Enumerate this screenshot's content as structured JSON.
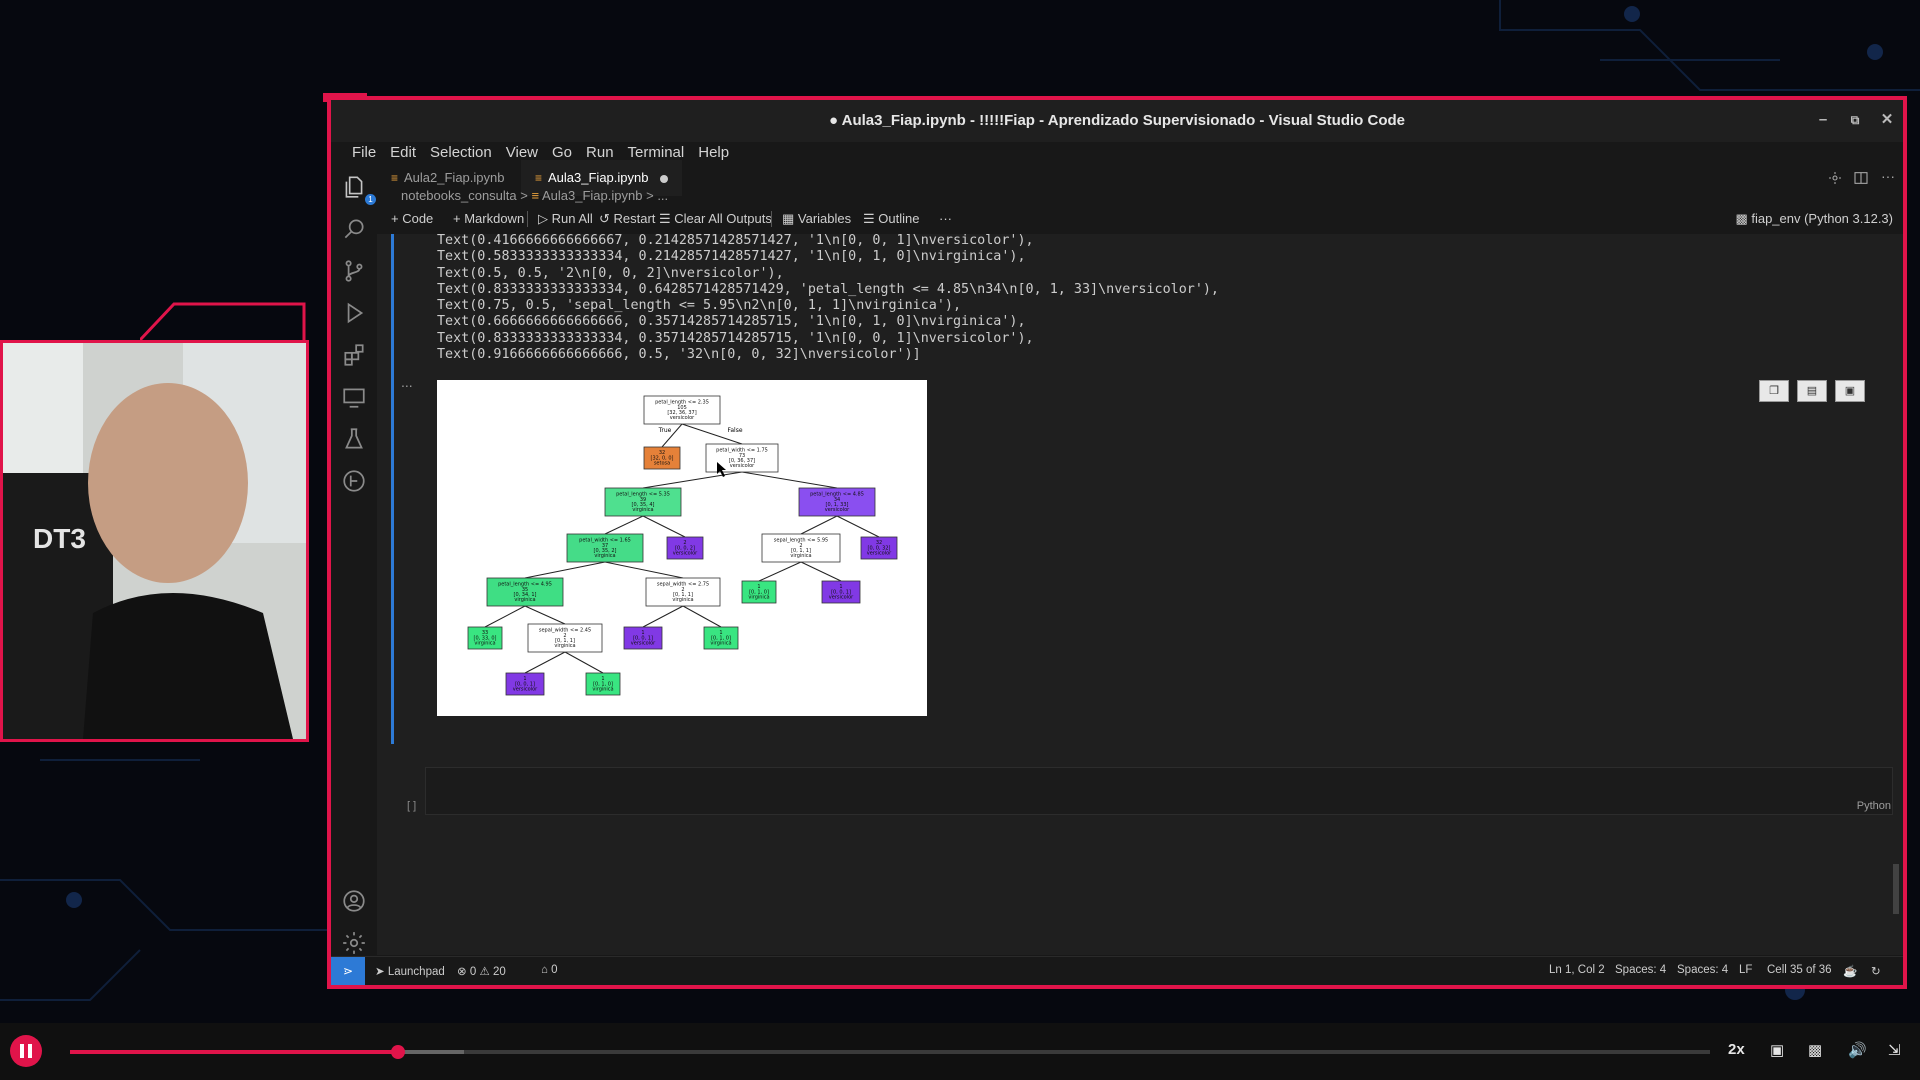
{
  "colors": {
    "accent": "#e0144a",
    "vscode_blue": "#2d7ad6",
    "notebook_icon": "#e8a03b"
  },
  "window": {
    "title": "● Aula3_Fiap.ipynb - !!!!!Fiap - Aprendizado Supervisionado - Visual Studio Code",
    "minimize_label": "–",
    "restore_label": "⧉",
    "close_label": "✕"
  },
  "menu": [
    "File",
    "Edit",
    "Selection",
    "View",
    "Go",
    "Run",
    "Terminal",
    "Help"
  ],
  "activity_bar": {
    "explorer_badge": "1"
  },
  "tabs": [
    {
      "label": "Aula2_Fiap.ipynb",
      "active": false
    },
    {
      "label": "Aula3_Fiap.ipynb",
      "active": true,
      "dirty": true
    }
  ],
  "breadcrumb": {
    "folder": "notebooks_consulta",
    "file": "Aula3_Fiap.ipynb",
    "more": "..."
  },
  "toolbar": {
    "code": "+ Code",
    "markdown": "+ Markdown",
    "run_all": "▷ Run All",
    "restart": "↺ Restart",
    "clear": "Clear All Outputs",
    "variables": "Variables",
    "outline": "Outline",
    "more": "···",
    "kernel": "fiap_env (Python 3.12.3)"
  },
  "output_lines": [
    "Text(0.4166666666666667, 0.21428571428571427, '1\\n[0, 0, 1]\\nversicolor'),",
    "Text(0.5833333333333334, 0.21428571428571427, '1\\n[0, 1, 0]\\nvirginica'),",
    "Text(0.5, 0.5, '2\\n[0, 0, 2]\\nversicolor'),",
    "Text(0.8333333333333334, 0.6428571428571429, 'petal_length <= 4.85\\n34\\n[0, 1, 33]\\nversicolor'),",
    "Text(0.75, 0.5, 'sepal_length <= 5.95\\n2\\n[0, 1, 1]\\nvirginica'),",
    "Text(0.6666666666666666, 0.35714285714285715, '1\\n[0, 1, 0]\\nvirginica'),",
    "Text(0.8333333333333334, 0.35714285714285715, '1\\n[0, 0, 1]\\nversicolor'),",
    "Text(0.9166666666666666, 0.5, '32\\n[0, 0, 32]\\nversicolor')]"
  ],
  "output_ellipsis": "...",
  "tree": {
    "true_label": "True",
    "false_label": "False",
    "nodes": [
      {
        "id": "n0",
        "lines": [
          "petal_length <= 2.35",
          "105",
          "[32, 36, 37]",
          "versicolor"
        ],
        "fill": "#ffffff"
      },
      {
        "id": "n1",
        "lines": [
          "32",
          "[32, 0, 0]",
          "setosa"
        ],
        "fill": "#e58139"
      },
      {
        "id": "n2",
        "lines": [
          "petal_width <= 1.75",
          "73",
          "[0, 36, 37]",
          "versicolor"
        ],
        "fill": "#ffffff"
      },
      {
        "id": "n3",
        "lines": [
          "petal_length <= 5.35",
          "39",
          "[0, 35, 4]",
          "virginica"
        ],
        "fill": "#4fe08f"
      },
      {
        "id": "n4",
        "lines": [
          "petal_length <= 4.85",
          "34",
          "[0, 1, 33]",
          "versicolor"
        ],
        "fill": "#8a4ff0"
      },
      {
        "id": "n5",
        "lines": [
          "petal_width <= 1.65",
          "37",
          "[0, 35, 2]",
          "virginica"
        ],
        "fill": "#45dc88"
      },
      {
        "id": "n6",
        "lines": [
          "2",
          "[0, 0, 2]",
          "versicolor"
        ],
        "fill": "#8139e5"
      },
      {
        "id": "n7",
        "lines": [
          "sepal_length <= 5.95",
          "2",
          "[0, 1, 1]",
          "virginica"
        ],
        "fill": "#ffffff"
      },
      {
        "id": "n8",
        "lines": [
          "32",
          "[0, 0, 32]",
          "versicolor"
        ],
        "fill": "#8139e5"
      },
      {
        "id": "n9",
        "lines": [
          "petal_length <= 4.95",
          "35",
          "[0, 34, 1]",
          "virginica"
        ],
        "fill": "#3fde84"
      },
      {
        "id": "n10",
        "lines": [
          "sepal_width <= 2.75",
          "2",
          "[0, 1, 1]",
          "virginica"
        ],
        "fill": "#ffffff"
      },
      {
        "id": "n11",
        "lines": [
          "1",
          "[0, 1, 0]",
          "virginica"
        ],
        "fill": "#39e581"
      },
      {
        "id": "n12",
        "lines": [
          "1",
          "[0, 0, 1]",
          "versicolor"
        ],
        "fill": "#8139e5"
      },
      {
        "id": "n13",
        "lines": [
          "33",
          "[0, 33, 0]",
          "virginica"
        ],
        "fill": "#39e581"
      },
      {
        "id": "n14",
        "lines": [
          "sepal_width <= 2.45",
          "2",
          "[0, 1, 1]",
          "virginica"
        ],
        "fill": "#ffffff"
      },
      {
        "id": "n15",
        "lines": [
          "1",
          "[0, 0, 1]",
          "versicolor"
        ],
        "fill": "#8139e5"
      },
      {
        "id": "n16",
        "lines": [
          "1",
          "[0, 1, 0]",
          "virginica"
        ],
        "fill": "#39e581"
      },
      {
        "id": "n17",
        "lines": [
          "1",
          "[0, 0, 1]",
          "versicolor"
        ],
        "fill": "#8139e5"
      },
      {
        "id": "n18",
        "lines": [
          "1",
          "[0, 1, 0]",
          "virginica"
        ],
        "fill": "#39e581"
      }
    ]
  },
  "empty_cell": {
    "exec_count": "[ ]",
    "language": "Python"
  },
  "statusbar": {
    "launchpad": "Launchpad",
    "errors": "⊗ 0",
    "warnings": "⚠ 20",
    "ports": "0",
    "position": "Ln 1, Col 2",
    "spaces1": "Spaces: 4",
    "spaces2": "Spaces: 4",
    "eol": "LF",
    "cell": "Cell 35 of 36"
  },
  "player": {
    "progress": 0.2,
    "buffered": 0.24,
    "speed": "2x"
  }
}
